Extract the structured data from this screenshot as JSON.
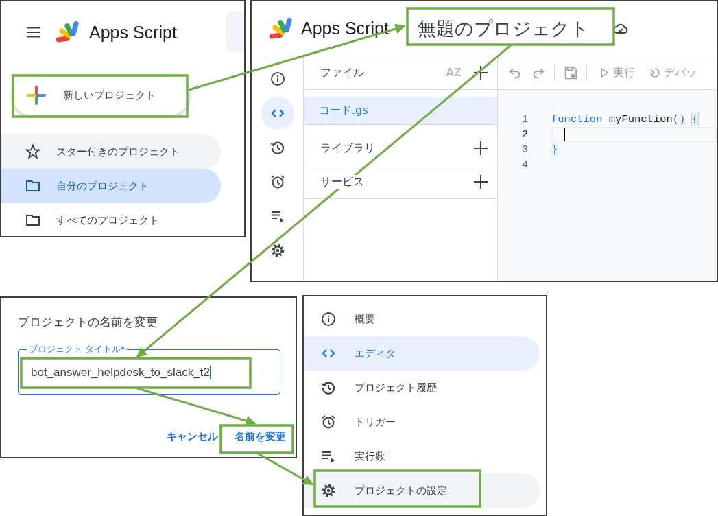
{
  "home": {
    "app_name": "Apps Script",
    "new_project": "新しいプロジェクト",
    "nav": [
      {
        "kind": "star",
        "label": "スター付きのプロジェクト",
        "selected": false,
        "hovered": true
      },
      {
        "kind": "folder",
        "label": "自分のプロジェクト",
        "selected": true,
        "hovered": false
      },
      {
        "kind": "folder",
        "label": "すべてのプロジェクト",
        "selected": false,
        "hovered": false
      }
    ]
  },
  "editor": {
    "app_name": "Apps Script",
    "project_title": "無題のプロジェクト",
    "rail": [
      {
        "kind": "info",
        "selected": false
      },
      {
        "kind": "code",
        "selected": true
      },
      {
        "kind": "history",
        "selected": false
      },
      {
        "kind": "alarm",
        "selected": false
      },
      {
        "kind": "executions",
        "selected": false
      },
      {
        "kind": "gear",
        "selected": false
      }
    ],
    "files_header": {
      "label": "ファイル",
      "sort": "AZ"
    },
    "files": [
      {
        "name": "コード.gs",
        "selected": true
      }
    ],
    "sections": [
      {
        "label": "ライブラリ"
      },
      {
        "label": "サービス"
      }
    ],
    "toolbar": [
      {
        "kind": "play",
        "label": "実行",
        "disabled": true
      },
      {
        "kind": "debug",
        "label": "デバッ",
        "disabled": true
      }
    ],
    "code": [
      {
        "number": "1",
        "current": false,
        "tokens": [
          {
            "kind": "keyword",
            "text": "function"
          },
          {
            "kind": "plain",
            "text": " myFunction"
          },
          {
            "kind": "bracket",
            "text": "()",
            "matched": false
          },
          {
            "kind": "bracket",
            "text": "{",
            "matched": true
          }
        ]
      },
      {
        "number": "2",
        "current": true
      },
      {
        "number": "3",
        "current": false,
        "tokens": [
          {
            "kind": "bracket",
            "text": "}",
            "matched": true
          }
        ]
      },
      {
        "number": "4",
        "current": false
      }
    ]
  },
  "rename_dialog": {
    "title": "プロジェクトの名前を変更",
    "field_label": "プロジェクト タイトル*",
    "value": "bot_answer_helpdesk_to_slack_t2",
    "buttons": [
      "キャンセル",
      "名前を変更"
    ]
  },
  "menu": [
    {
      "kind": "info",
      "label": "概要",
      "selected": false,
      "hovered": false
    },
    {
      "kind": "code",
      "label": "エディタ",
      "selected": true,
      "hovered": false
    },
    {
      "kind": "history",
      "label": "プロジェクト履歴",
      "selected": false,
      "hovered": false
    },
    {
      "kind": "alarm",
      "label": "トリガー",
      "selected": false,
      "hovered": false
    },
    {
      "kind": "executions",
      "label": "実行数",
      "selected": false,
      "hovered": false
    },
    {
      "kind": "gear",
      "label": "プロジェクトの設定",
      "selected": false,
      "hovered": true
    }
  ]
}
